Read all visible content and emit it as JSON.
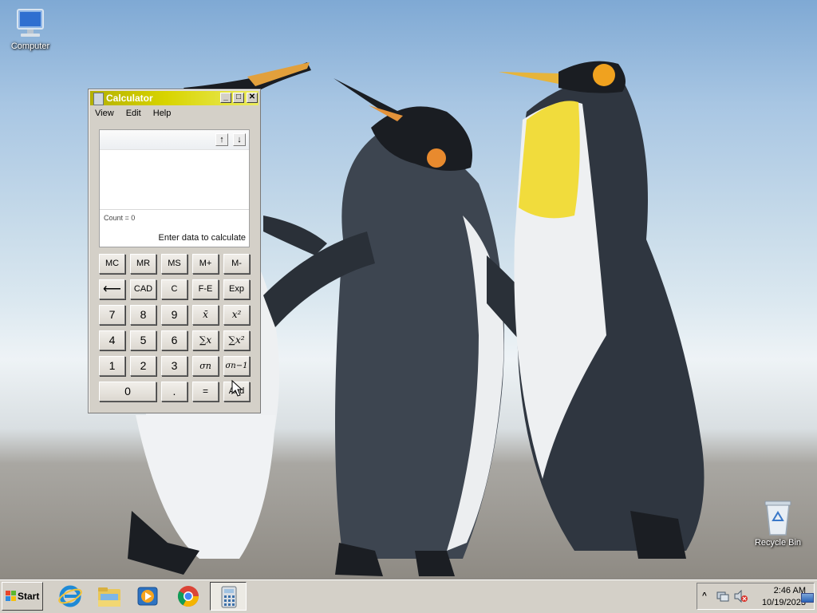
{
  "desktop": {
    "icons": [
      {
        "label": "Computer",
        "icon": "computer-icon"
      },
      {
        "label": "Recycle Bin",
        "icon": "recycle-bin-icon"
      }
    ]
  },
  "calculator": {
    "title": "Calculator",
    "menu": [
      "View",
      "Edit",
      "Help"
    ],
    "history_up": "↑",
    "history_down": "↓",
    "count": "Count = 0",
    "prompt": "Enter data to calculate",
    "keys": {
      "mc": "MC",
      "mr": "MR",
      "ms": "MS",
      "mplus": "M+",
      "mminus": "M-",
      "back": "⟵",
      "cad": "CAD",
      "c": "C",
      "fe": "F-E",
      "exp": "Exp",
      "seven": "7",
      "eight": "8",
      "nine": "9",
      "mean": "x̄",
      "mean_sq": "x²",
      "four": "4",
      "five": "5",
      "six": "6",
      "sum": "∑x",
      "sum_sq": "∑x²",
      "one": "1",
      "two": "2",
      "three": "3",
      "sigma_n": "σn",
      "sigma_n1": "σn−1",
      "zero": "0",
      "dot": ".",
      "equals": "=",
      "add": "Add"
    }
  },
  "taskbar": {
    "start_label": "Start",
    "apps": [
      "internet-explorer-icon",
      "file-explorer-icon",
      "media-player-icon",
      "chrome-icon",
      "calculator-icon"
    ],
    "tray": {
      "chevron": "^",
      "time": "2:46 AM",
      "date": "10/19/2023"
    }
  }
}
